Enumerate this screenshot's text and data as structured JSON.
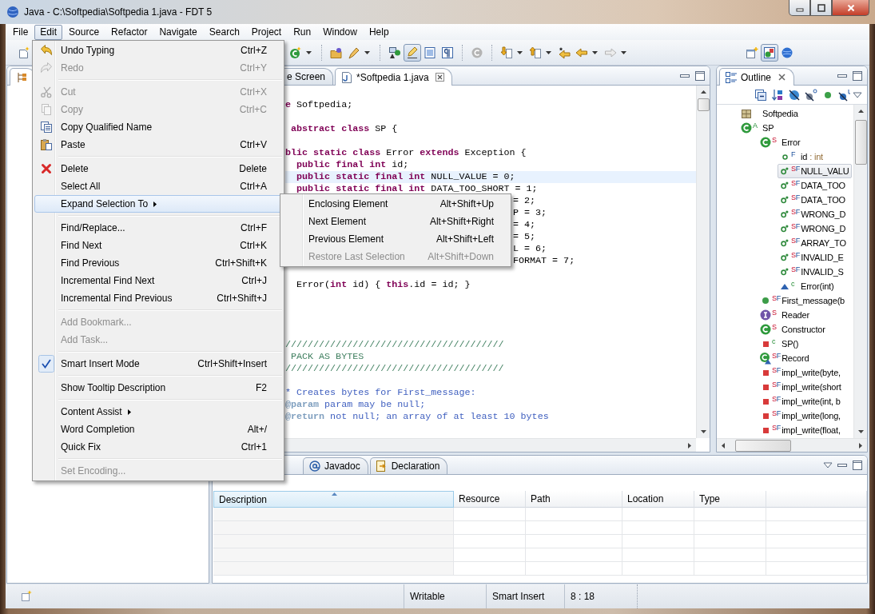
{
  "window": {
    "title": "Java - C:\\Softpedia\\Softpedia 1.java - FDT 5"
  },
  "menubar": [
    {
      "label": "File",
      "selected": false
    },
    {
      "label": "Edit",
      "selected": true
    },
    {
      "label": "Source",
      "selected": false
    },
    {
      "label": "Refactor",
      "selected": false
    },
    {
      "label": "Navigate",
      "selected": false
    },
    {
      "label": "Search",
      "selected": false
    },
    {
      "label": "Project",
      "selected": false
    },
    {
      "label": "Run",
      "selected": false
    },
    {
      "label": "Window",
      "selected": false
    },
    {
      "label": "Help",
      "selected": false
    }
  ],
  "toolbar": {
    "groups": [
      {
        "items": [
          {
            "pressed": false,
            "dropdown": false
          }
        ]
      },
      {
        "items": [
          {
            "pressed": false,
            "dropdown": true
          }
        ]
      },
      {
        "items": [
          {
            "pressed": false,
            "dropdown": false
          },
          {
            "pressed": false,
            "dropdown": true
          }
        ]
      },
      {
        "items": [
          {
            "pressed": false,
            "dropdown": false
          },
          {
            "pressed": true,
            "dropdown": false
          },
          {
            "pressed": false,
            "dropdown": false
          },
          {
            "pressed": false,
            "dropdown": false
          }
        ]
      },
      {
        "items": [
          {
            "pressed": false,
            "dropdown": false
          }
        ]
      },
      {
        "items": [
          {
            "pressed": false,
            "dropdown": true
          },
          {
            "pressed": false,
            "dropdown": true
          },
          {
            "pressed": false,
            "dropdown": false
          },
          {
            "pressed": false,
            "dropdown": true
          },
          {
            "pressed": false,
            "dropdown": true
          }
        ]
      }
    ],
    "perspectives": [
      {
        "pressed": false
      },
      {
        "pressed": true
      },
      {
        "pressed": false
      }
    ]
  },
  "left_view": {
    "tab": {
      "selected": true
    }
  },
  "editor": {
    "tabs": [
      {
        "label": "e Screen",
        "selected": false,
        "closable": false
      },
      {
        "label": "*Softpedia 1.java",
        "selected": true,
        "closable": true
      }
    ],
    "lines": [
      {
        "kind": "code",
        "text": "**e** Softpedia;",
        "current": false
      },
      {
        "kind": "blank"
      },
      {
        "kind": "code",
        "text": " **abstract class** SP {",
        "current": false
      },
      {
        "kind": "blank"
      },
      {
        "kind": "code",
        "text": "**blic static class** Error **extends** Exception {",
        "current": false
      },
      {
        "kind": "code",
        "text": "  **public final int** id;",
        "current": false
      },
      {
        "kind": "code",
        "text": "  **public static final int** NULL_VALUE = 0;",
        "current": true
      },
      {
        "kind": "code",
        "text": "  **public static final int** DATA_TOO_SHORT = 1;",
        "current": false
      },
      {
        "kind": "tail",
        "text": "= 2;",
        "current": false
      },
      {
        "kind": "tail",
        "text": "P = 3;",
        "current": false
      },
      {
        "kind": "tail",
        "text": "= 4;",
        "current": false
      },
      {
        "kind": "tail",
        "text": "= 5;",
        "current": false
      },
      {
        "kind": "tail",
        "text": "L = 6;",
        "current": false
      },
      {
        "kind": "tail",
        "text": "FORMAT = 7;",
        "current": false
      },
      {
        "kind": "blank"
      },
      {
        "kind": "code",
        "text": "  Error(**int** id) { **this**.id = id; }",
        "current": false
      },
      {
        "kind": "blank"
      },
      {
        "kind": "blank"
      },
      {
        "kind": "blank"
      },
      {
        "kind": "blank"
      },
      {
        "kind": "comment",
        "text": "///////////////////////////////////////",
        "current": false
      },
      {
        "kind": "comment",
        "text": " PACK AS BYTES",
        "current": false
      },
      {
        "kind": "comment",
        "text": "///////////////////////////////////////",
        "current": false
      },
      {
        "kind": "blank"
      },
      {
        "kind": "doc",
        "text": "* Creates bytes for First_message:",
        "current": false
      },
      {
        "kind": "doc",
        "text": "**@param** param may be null;",
        "current": false
      },
      {
        "kind": "doc",
        "text": "**@return** not null; an array of at least 10 bytes",
        "current": false
      }
    ]
  },
  "outline": {
    "tab": {
      "label": "Outline",
      "selected": true
    },
    "tree": [
      {
        "label": "Softpedia",
        "kind": "package",
        "selected": false
      },
      {
        "label": "SP",
        "kind": "class",
        "modifiers": [
          {
            "text": "A",
            "kind": "abstract"
          }
        ],
        "selected": false,
        "children": [
          {
            "label": "Error",
            "kind": "class",
            "modifiers": [
              {
                "text": "S",
                "kind": "static"
              }
            ],
            "selected": false,
            "children": [
              {
                "label": "id",
                "type": ": int",
                "kind": "field",
                "modifiers": [
                  {
                    "text": "F",
                    "kind": "final"
                  }
                ],
                "selected": false
              },
              {
                "label": "NULL_VALU",
                "kind": "constant",
                "modifiers": [
                  {
                    "text": "S",
                    "kind": "static"
                  },
                  {
                    "text": "F",
                    "kind": "final"
                  }
                ],
                "selected": true
              },
              {
                "label": "DATA_TOO",
                "kind": "constant",
                "modifiers": [
                  {
                    "text": "S",
                    "kind": "static"
                  },
                  {
                    "text": "F",
                    "kind": "final"
                  }
                ],
                "selected": false
              },
              {
                "label": "DATA_TOO",
                "kind": "constant",
                "modifiers": [
                  {
                    "text": "S",
                    "kind": "static"
                  },
                  {
                    "text": "F",
                    "kind": "final"
                  }
                ],
                "selected": false
              },
              {
                "label": "WRONG_D",
                "kind": "constant",
                "modifiers": [
                  {
                    "text": "S",
                    "kind": "static"
                  },
                  {
                    "text": "F",
                    "kind": "final"
                  }
                ],
                "selected": false
              },
              {
                "label": "WRONG_D",
                "kind": "constant",
                "modifiers": [
                  {
                    "text": "S",
                    "kind": "static"
                  },
                  {
                    "text": "F",
                    "kind": "final"
                  }
                ],
                "selected": false
              },
              {
                "label": "ARRAY_TO",
                "kind": "constant",
                "modifiers": [
                  {
                    "text": "S",
                    "kind": "static"
                  },
                  {
                    "text": "F",
                    "kind": "final"
                  }
                ],
                "selected": false
              },
              {
                "label": "INVALID_E",
                "kind": "constant",
                "modifiers": [
                  {
                    "text": "S",
                    "kind": "static"
                  },
                  {
                    "text": "F",
                    "kind": "final"
                  }
                ],
                "selected": false
              },
              {
                "label": "INVALID_S",
                "kind": "constant",
                "modifiers": [
                  {
                    "text": "S",
                    "kind": "static"
                  },
                  {
                    "text": "F",
                    "kind": "final"
                  }
                ],
                "selected": false
              },
              {
                "label": "Error(int)",
                "kind": "constructor",
                "modifiers": [
                  {
                    "text": "c",
                    "kind": "constructor"
                  }
                ],
                "selected": false
              }
            ]
          },
          {
            "label": "First_message(b",
            "kind": "method",
            "modifiers": [
              {
                "text": "S",
                "kind": "static"
              },
              {
                "text": "F",
                "kind": "final"
              }
            ],
            "selected": false
          },
          {
            "label": "Reader",
            "kind": "interface",
            "modifiers": [
              {
                "text": "S",
                "kind": "static"
              }
            ],
            "selected": false
          },
          {
            "label": "Constructor",
            "kind": "class",
            "modifiers": [
              {
                "text": "S",
                "kind": "static"
              }
            ],
            "selected": false
          },
          {
            "label": "SP()",
            "kind": "private",
            "modifiers": [
              {
                "text": "c",
                "kind": "constructor"
              }
            ],
            "selected": false
          },
          {
            "label": "Record",
            "kind": "record",
            "modifiers": [
              {
                "text": "S",
                "kind": "static"
              },
              {
                "text": "F",
                "kind": "final"
              }
            ],
            "selected": false
          },
          {
            "label": "impl_write(byte,",
            "kind": "private",
            "modifiers": [
              {
                "text": "S",
                "kind": "static"
              },
              {
                "text": "F",
                "kind": "final"
              }
            ],
            "selected": false
          },
          {
            "label": "impl_write(short",
            "kind": "private",
            "modifiers": [
              {
                "text": "S",
                "kind": "static"
              },
              {
                "text": "F",
                "kind": "final"
              }
            ],
            "selected": false
          },
          {
            "label": "impl_write(int, b",
            "kind": "private",
            "modifiers": [
              {
                "text": "S",
                "kind": "static"
              },
              {
                "text": "F",
                "kind": "final"
              }
            ],
            "selected": false
          },
          {
            "label": "impl_write(long,",
            "kind": "private",
            "modifiers": [
              {
                "text": "S",
                "kind": "static"
              },
              {
                "text": "F",
                "kind": "final"
              }
            ],
            "selected": false
          },
          {
            "label": "impl_write(float,",
            "kind": "private",
            "modifiers": [
              {
                "text": "S",
                "kind": "static"
              },
              {
                "text": "F",
                "kind": "final"
              }
            ],
            "selected": false
          }
        ]
      }
    ]
  },
  "bottom_view": {
    "tabs": [
      {
        "label": "Javadoc",
        "selected": false
      },
      {
        "label": "Declaration",
        "selected": false
      }
    ],
    "table": {
      "columns": [
        {
          "label": "Description",
          "sorted": true
        },
        {
          "label": "Resource",
          "sorted": false
        },
        {
          "label": "Path",
          "sorted": false
        },
        {
          "label": "Location",
          "sorted": false
        },
        {
          "label": "Type",
          "sorted": false
        }
      ]
    }
  },
  "status_bar": {
    "fields": [
      "Writable",
      "Smart Insert",
      "8 : 18"
    ]
  },
  "edit_menu": {
    "groups": [
      {
        "items": [
          {
            "label": "Undo Typing",
            "shortcut": "Ctrl+Z",
            "disabled": false,
            "checked": false,
            "selected": false,
            "submenu": false
          },
          {
            "label": "Redo",
            "shortcut": "Ctrl+Y",
            "disabled": true,
            "checked": false,
            "selected": false,
            "submenu": false
          }
        ]
      },
      {
        "items": [
          {
            "label": "Cut",
            "shortcut": "Ctrl+X",
            "disabled": true,
            "checked": false,
            "selected": false,
            "submenu": false
          },
          {
            "label": "Copy",
            "shortcut": "Ctrl+C",
            "disabled": true,
            "checked": false,
            "selected": false,
            "submenu": false
          },
          {
            "label": "Copy Qualified Name",
            "disabled": false,
            "checked": false,
            "selected": false,
            "submenu": false
          },
          {
            "label": "Paste",
            "shortcut": "Ctrl+V",
            "disabled": false,
            "checked": false,
            "selected": false,
            "submenu": false
          }
        ]
      },
      {
        "items": [
          {
            "label": "Delete",
            "shortcut": "Delete",
            "disabled": false,
            "checked": false,
            "selected": false,
            "submenu": false
          },
          {
            "label": "Select All",
            "shortcut": "Ctrl+A",
            "disabled": false,
            "checked": false,
            "selected": false,
            "submenu": false
          },
          {
            "label": "Expand Selection To",
            "disabled": false,
            "checked": false,
            "selected": true,
            "submenu": true
          }
        ]
      },
      {
        "items": [
          {
            "label": "Find/Replace...",
            "shortcut": "Ctrl+F",
            "disabled": false,
            "checked": false,
            "selected": false,
            "submenu": false
          },
          {
            "label": "Find Next",
            "shortcut": "Ctrl+K",
            "disabled": false,
            "checked": false,
            "selected": false,
            "submenu": false
          },
          {
            "label": "Find Previous",
            "shortcut": "Ctrl+Shift+K",
            "disabled": false,
            "checked": false,
            "selected": false,
            "submenu": false
          },
          {
            "label": "Incremental Find Next",
            "shortcut": "Ctrl+J",
            "disabled": false,
            "checked": false,
            "selected": false,
            "submenu": false
          },
          {
            "label": "Incremental Find Previous",
            "shortcut": "Ctrl+Shift+J",
            "disabled": false,
            "checked": false,
            "selected": false,
            "submenu": false
          }
        ]
      },
      {
        "items": [
          {
            "label": "Add Bookmark...",
            "disabled": true,
            "checked": false,
            "selected": false,
            "submenu": false
          },
          {
            "label": "Add Task...",
            "disabled": true,
            "checked": false,
            "selected": false,
            "submenu": false
          }
        ]
      },
      {
        "items": [
          {
            "label": "Smart Insert Mode",
            "shortcut": "Ctrl+Shift+Insert",
            "disabled": false,
            "checked": true,
            "selected": false,
            "submenu": false
          }
        ]
      },
      {
        "items": [
          {
            "label": "Show Tooltip Description",
            "shortcut": "F2",
            "disabled": false,
            "checked": false,
            "selected": false,
            "submenu": false
          }
        ]
      },
      {
        "items": [
          {
            "label": "Content Assist",
            "disabled": false,
            "checked": false,
            "selected": false,
            "submenu": true
          },
          {
            "label": "Word Completion",
            "shortcut": "Alt+/",
            "disabled": false,
            "checked": false,
            "selected": false,
            "submenu": false
          },
          {
            "label": "Quick Fix",
            "shortcut": "Ctrl+1",
            "disabled": false,
            "checked": false,
            "selected": false,
            "submenu": false
          }
        ]
      },
      {
        "items": [
          {
            "label": "Set Encoding...",
            "disabled": true,
            "checked": false,
            "selected": false,
            "submenu": false
          }
        ]
      }
    ]
  },
  "submenu": {
    "items": [
      {
        "label": "Enclosing Element",
        "shortcut": "Alt+Shift+Up",
        "disabled": false,
        "selected": false
      },
      {
        "label": "Next Element",
        "shortcut": "Alt+Shift+Right",
        "disabled": false,
        "selected": false
      },
      {
        "label": "Previous Element",
        "shortcut": "Alt+Shift+Left",
        "disabled": false,
        "selected": false
      },
      {
        "label": "Restore Last Selection",
        "shortcut": "Alt+Shift+Down",
        "disabled": true,
        "selected": false
      }
    ]
  }
}
